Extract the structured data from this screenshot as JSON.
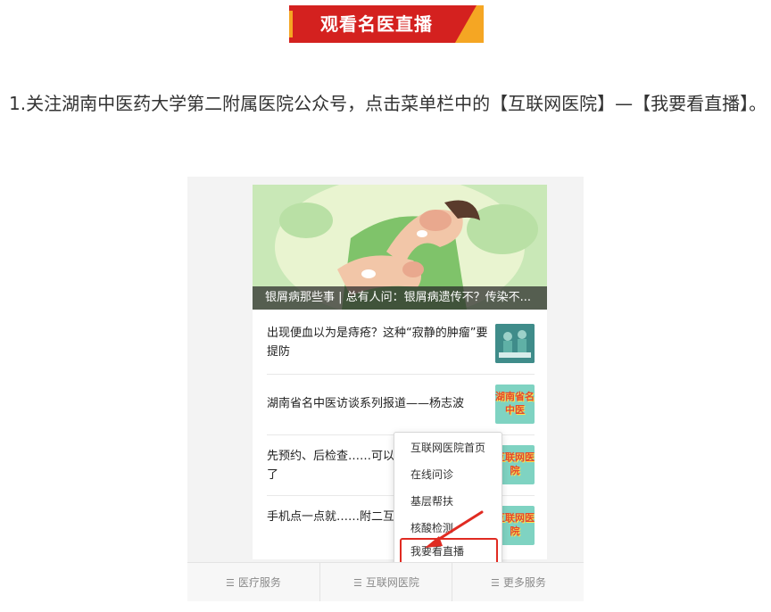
{
  "banner": {
    "title": "观看名医直播",
    "colors": {
      "red": "#d4211f",
      "orange": "#f5a623"
    }
  },
  "instruction": "1.关注湖南中医药大学第二附属医院公众号，点击菜单栏中的【互联网医院】—【我要看直播】。",
  "phone": {
    "hero": {
      "caption": "银屑病那些事 | 总有人问：银屑病遗传不？传染不..."
    },
    "articles": [
      {
        "title": "出现便血以为是痔疮？这种“寂静的肿瘤”要提防",
        "thumb_icon": "surgery-photo-icon"
      },
      {
        "title": "湖南省名中医访谈系列报道——杨志波",
        "thumb_text": "湖南省名中医"
      },
      {
        "title": "先预约、后检查……可以线上预约检验检查了",
        "thumb_text": "互联网医院"
      },
      {
        "title": "手机点一点就……附二互联网医院为您解锁",
        "thumb_text": "互联网医院"
      }
    ],
    "popup_menu": [
      "互联网医院首页",
      "在线问诊",
      "基层帮扶",
      "核酸检测",
      "我要看直播"
    ],
    "bottom_nav": [
      {
        "icon": "menu-icon",
        "label": "医疗服务"
      },
      {
        "icon": "menu-icon",
        "label": "互联网医院"
      },
      {
        "icon": "menu-icon",
        "label": "更多服务"
      }
    ]
  },
  "highlight_color": "#e02b22"
}
